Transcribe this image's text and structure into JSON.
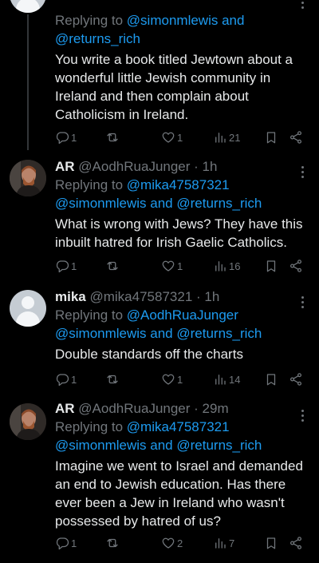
{
  "tweets": [
    {
      "name": "",
      "handle": "",
      "time": "",
      "replying_prefix": "Replying to",
      "replying_link1": "@simonmlewis and",
      "replying_link2": "@returns_rich",
      "text": "You write a book titled Jewtown about a wonderful little Jewish community in Ireland and then complain about Catholicism in Ireland.",
      "replies": "1",
      "reposts": "",
      "likes": "1",
      "views": "21",
      "avatar": "default"
    },
    {
      "name": "AR",
      "handle": "@AodhRuaJunger",
      "time": "· 1h",
      "replying_prefix": "Replying to",
      "replying_link1": "@mika47587321",
      "replying_link2": "@simonmlewis and @returns_rich",
      "text": "What is wrong with Jews? They have this inbuilt hatred for Irish Gaelic Catholics.",
      "replies": "1",
      "reposts": "",
      "likes": "1",
      "views": "16",
      "avatar": "photo"
    },
    {
      "name": "mika",
      "handle": "@mika47587321",
      "time": "· 1h",
      "replying_prefix": "Replying to",
      "replying_link1": "@AodhRuaJunger",
      "replying_link2": "@simonmlewis and @returns_rich",
      "text": "Double standards off the charts",
      "replies": "1",
      "reposts": "",
      "likes": "1",
      "views": "14",
      "avatar": "default"
    },
    {
      "name": "AR",
      "handle": "@AodhRuaJunger",
      "time": "· 29m",
      "replying_prefix": "Replying to",
      "replying_link1": "@mika47587321",
      "replying_link2": "@simonmlewis and @returns_rich",
      "text": "Imagine we went to Israel and demanded an end to Jewish education. Has there ever been a Jew in Ireland who wasn't possessed by hatred of us?",
      "replies": "1",
      "reposts": "",
      "likes": "2",
      "views": "7",
      "avatar": "photo"
    }
  ],
  "icons": [
    "reply-icon",
    "repost-icon",
    "like-icon",
    "views-icon",
    "bookmark-icon",
    "share-icon",
    "more-icon"
  ],
  "colors": {
    "background": "#000000",
    "text": "#e7e9ea",
    "muted": "#71767b",
    "link": "#1d9bf0"
  }
}
